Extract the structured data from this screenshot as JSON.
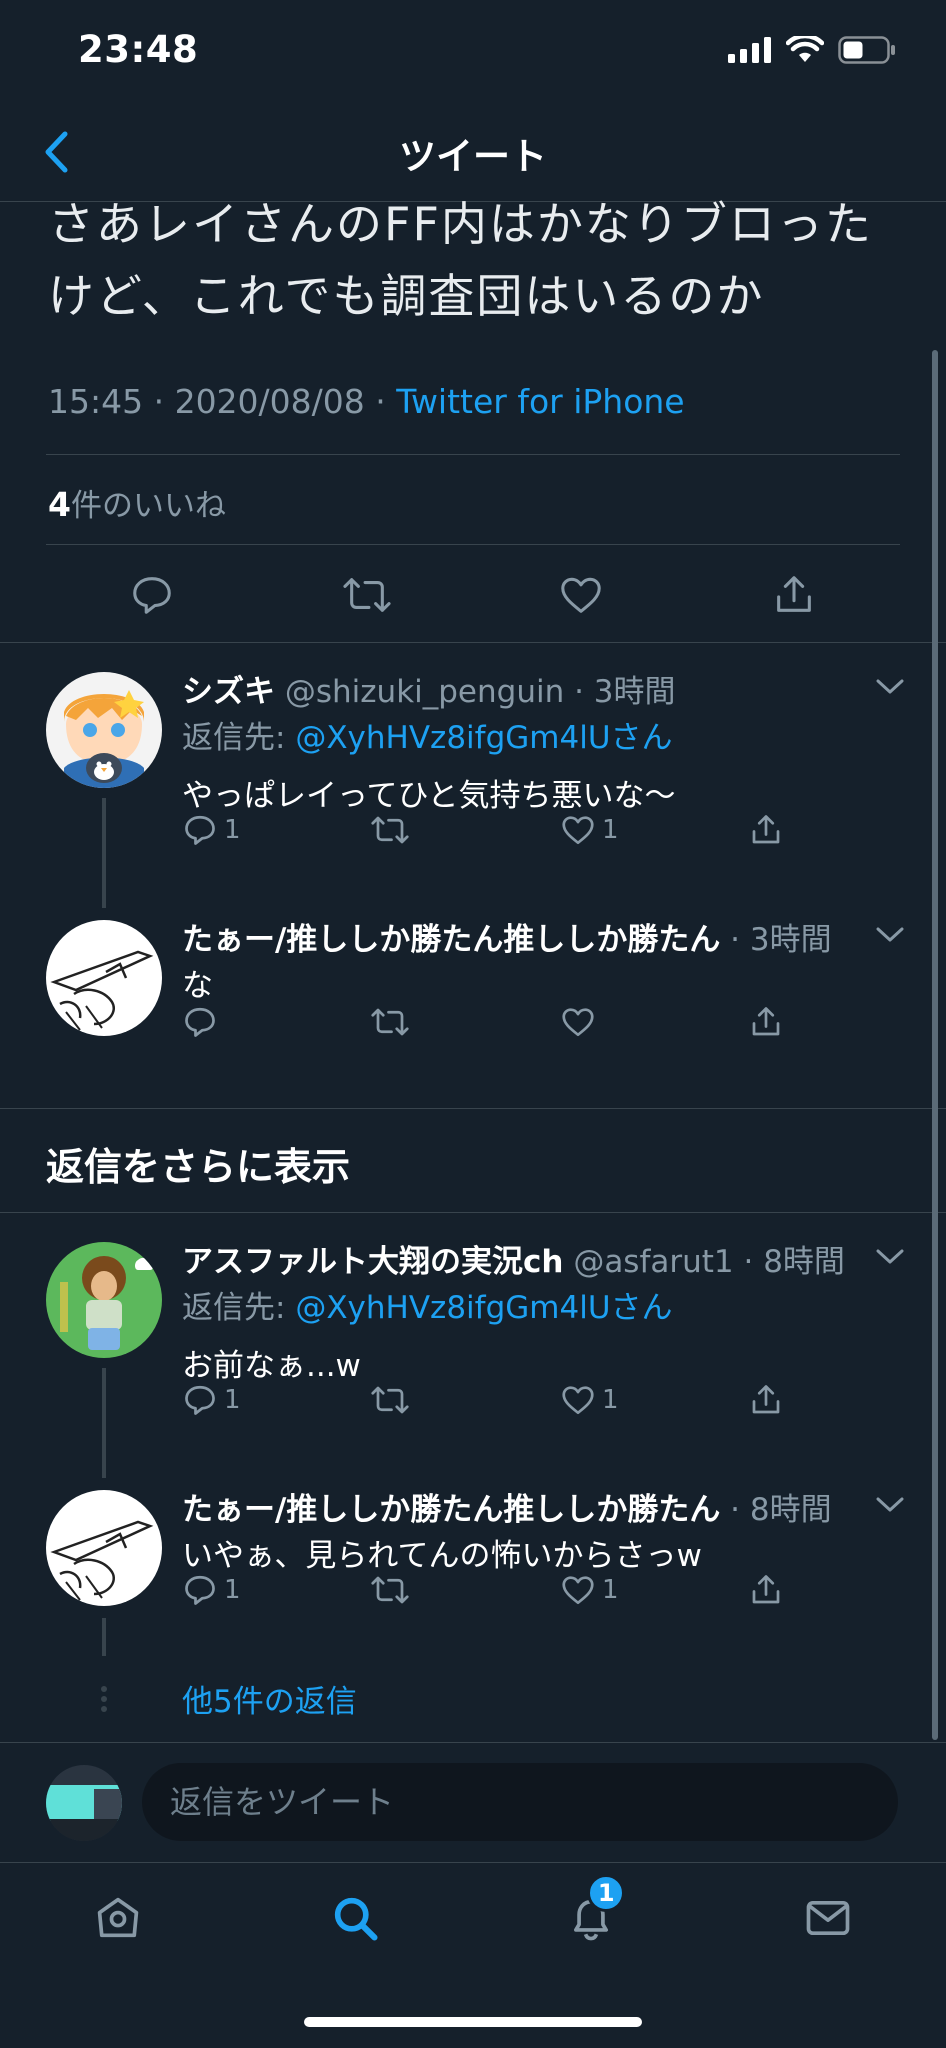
{
  "status_bar": {
    "time": "23:48"
  },
  "nav": {
    "title": "ツイート"
  },
  "tweet": {
    "text": "さあレイさんのFF内はかなりブロったけど、これでも調査団はいるのか",
    "time_date": "15:45 · 2020/08/08 · ",
    "source": "Twitter for iPhone",
    "likes_count": "4",
    "likes_label": "件のいいね"
  },
  "replies": [
    {
      "name": "シズキ",
      "handle": "@shizuki_penguin",
      "time": " · 3時間",
      "reply_to_prefix": "返信先: ",
      "reply_to_handle": "@XyhHVz8ifgGm4lUさん",
      "text": "やっぱレイってひと気持ち悪いな〜",
      "reply_count": "1",
      "like_count": "1"
    },
    {
      "name": "たぁー/推ししか勝たん推ししか勝たん",
      "time": " · 3時間",
      "text": "な"
    }
  ],
  "more_section": {
    "title": "返信をさらに表示"
  },
  "more_replies": [
    {
      "name": "アスファルト大翔の実況ch",
      "handle": "@asfarut1",
      "time": " · 8時間",
      "reply_to_prefix": "返信先: ",
      "reply_to_handle": "@XyhHVz8ifgGm4lUさん",
      "text": "お前なぁ...w",
      "reply_count": "1",
      "like_count": "1"
    },
    {
      "name": "たぁー/推ししか勝たん推ししか勝たん",
      "time": " · 8時間",
      "text": "いやぁ、見られてんの怖いからさっw",
      "reply_count": "1",
      "like_count": "1"
    }
  ],
  "other_replies_link": "他5件の返信",
  "compose": {
    "placeholder": "返信をツイート"
  },
  "tabbar": {
    "notification_badge": "1"
  },
  "colors": {
    "background": "#15202b",
    "accent": "#1da1f2",
    "muted": "#8899a6",
    "divider": "#38444d"
  }
}
